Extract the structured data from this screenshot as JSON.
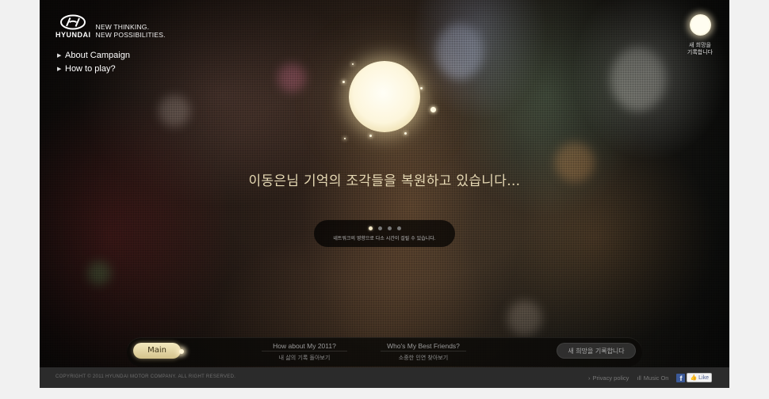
{
  "brand": {
    "logo_word": "HYUNDAI",
    "slogan_line1": "NEW THINKING.",
    "slogan_line2": "NEW POSSIBILITIES."
  },
  "menu": [
    {
      "label": "About Campaign"
    },
    {
      "label": "How to play?"
    }
  ],
  "wish_corner": {
    "line1": "새 희망을",
    "line2": "기록합니다"
  },
  "headline": "이동은님 기억의 조각들을 복원하고 있습니다…",
  "loader": {
    "dots_total": 4,
    "active_index": 0,
    "note": "네트워크의 영향으로 다소 시간이 걸릴 수 있습니다."
  },
  "bottom_nav": {
    "main_label": "Main",
    "items": [
      {
        "en": "How about My 2011?",
        "ko": "내 삶의 기록 돌아보기"
      },
      {
        "en": "Who's My Best Friends?",
        "ko": "소중한 인연 찾아보기"
      }
    ],
    "wish_button": "새 희망을 기록합니다"
  },
  "footer": {
    "copyright": "COPYRIGHT © 2011 HYUNDAI MOTOR COMPANY.  ALL RIGHT RESERVED.",
    "privacy": "Privacy policy",
    "music": "Music On",
    "fb_like": "Like"
  },
  "colors": {
    "headline": "#e6d9b4",
    "main_button": "#e8dcaa",
    "footer_bg": "#2b2b2b",
    "page_bg": "#f1f1f1"
  }
}
